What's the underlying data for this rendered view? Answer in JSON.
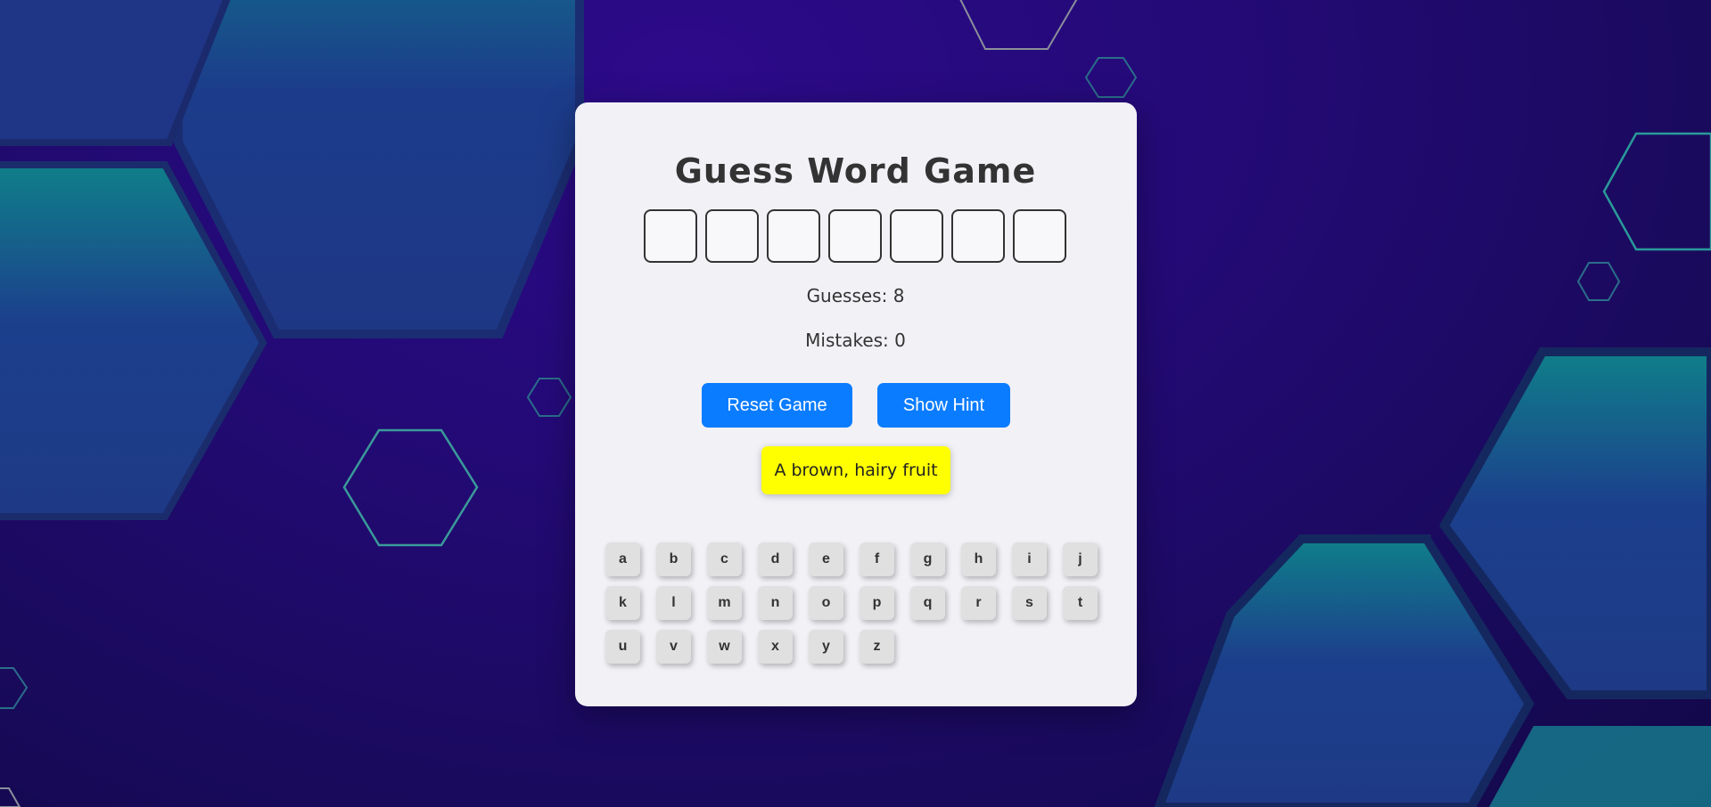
{
  "game": {
    "title": "Guess Word Game",
    "word_length": 7,
    "slots": [
      "",
      "",
      "",
      "",
      "",
      "",
      ""
    ],
    "guesses_text": "Guesses: 8",
    "mistakes_text": "Mistakes: 0",
    "hint_text": "A brown, hairy fruit"
  },
  "buttons": {
    "reset_label": "Reset Game",
    "hint_label": "Show Hint"
  },
  "keyboard": {
    "rows": [
      [
        "a",
        "b",
        "c",
        "d",
        "e",
        "f",
        "g",
        "h",
        "i",
        "j"
      ],
      [
        "k",
        "l",
        "m",
        "n",
        "o",
        "p",
        "q",
        "r",
        "s",
        "t"
      ],
      [
        "u",
        "v",
        "w",
        "x",
        "y",
        "z"
      ]
    ]
  },
  "colors": {
    "button": "#0a7cff",
    "hint_bg": "#ffff00",
    "card_bg": "#f2f1f6",
    "background": "#240a78"
  }
}
